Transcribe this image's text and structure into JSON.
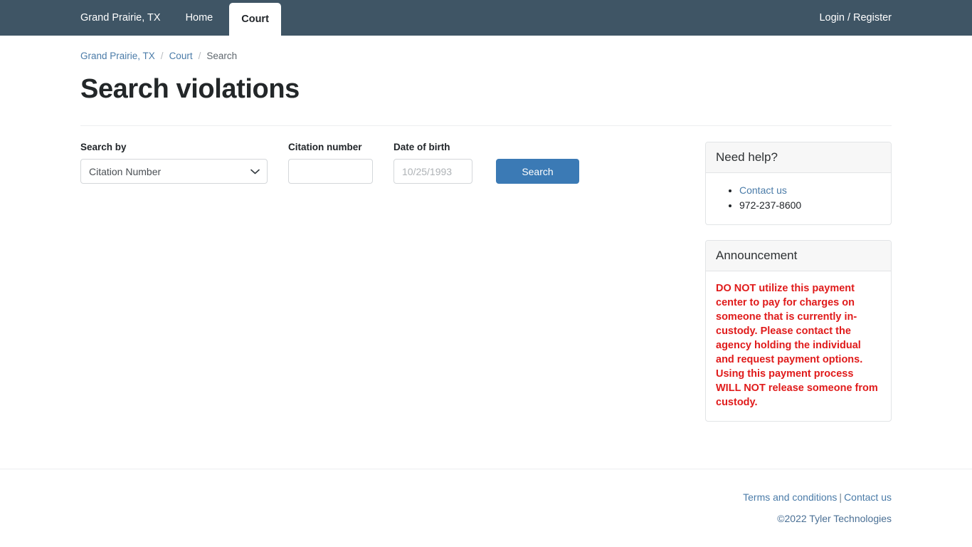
{
  "navbar": {
    "brand": "Grand Prairie, TX",
    "items": [
      {
        "label": "Home",
        "active": false
      },
      {
        "label": "Court",
        "active": true
      }
    ],
    "login_label": "Login / Register",
    "background_color": "#3f5565"
  },
  "breadcrumb": {
    "items": [
      {
        "label": "Grand Prairie, TX",
        "link": true
      },
      {
        "label": "Court",
        "link": true
      },
      {
        "label": "Search",
        "link": false
      }
    ],
    "separator": "/"
  },
  "page": {
    "title": "Search violations"
  },
  "form": {
    "search_by": {
      "label": "Search by",
      "value": "Citation Number",
      "options": [
        "Citation Number"
      ],
      "chevron_icon": "chevron-down-icon"
    },
    "citation_number": {
      "label": "Citation number",
      "value": "",
      "placeholder": ""
    },
    "date_of_birth": {
      "label": "Date of birth",
      "value": "",
      "placeholder": "10/25/1993"
    },
    "search_button": {
      "label": "Search",
      "color": "#3b7ab5"
    }
  },
  "sidebar": {
    "help_card": {
      "title": "Need help?",
      "items": [
        {
          "label": "Contact us",
          "link": true
        },
        {
          "label": "972-237-8600",
          "link": false
        }
      ]
    },
    "announcement_card": {
      "title": "Announcement",
      "text": "DO NOT utilize this payment center to pay for charges on someone that is currently in-custody.  Please contact the agency holding the individual and request payment options.  Using this payment process WILL NOT release someone from custody.",
      "text_color": "#e01b1b"
    }
  },
  "footer": {
    "terms_label": "Terms and conditions",
    "separator": "|",
    "contact_label": "Contact us",
    "copyright": "©2022 Tyler Technologies"
  }
}
